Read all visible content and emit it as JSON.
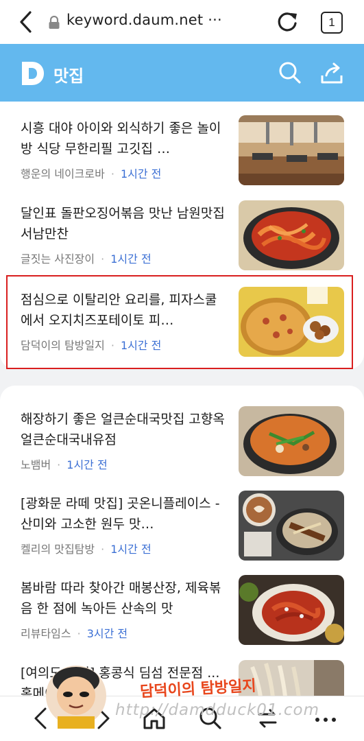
{
  "browser": {
    "url": "keyword.daum.net ···",
    "tab_count": "1"
  },
  "header": {
    "title": "맛집"
  },
  "articles": [
    {
      "title": "시흥 대야 아이와 외식하기 좋은 놀이방 식당 무한리필 고깃집 …",
      "source": "행운의 네이크로바",
      "time": "1시간 전",
      "thumb": "restaurant-interior"
    },
    {
      "title": "달인표 돌판오징어볶음 맛난 남원맛집 서남만찬",
      "source": "글짓는 사진장이",
      "time": "1시간 전",
      "thumb": "spicy-squid"
    },
    {
      "title": "점심으로 이탈리안 요리를, 피자스쿨에서 오지치즈포테이토 피…",
      "source": "담덕이의 탐방일지",
      "time": "1시간 전",
      "thumb": "pizza",
      "highlighted": true
    },
    {
      "title": "해장하기 좋은 얼큰순대국맛집 고향옥얼큰순대국내유점",
      "source": "노뱀버",
      "time": "1시간 전",
      "thumb": "sundae-soup"
    },
    {
      "title": "[광화문 라떼 맛집] 곳온니플레이스 - 산미와 고소한 원두 맛…",
      "source": "켈리의 맛집탐방",
      "time": "1시간 전",
      "thumb": "latte-dessert"
    },
    {
      "title": "봄바람 따라 찾아간 매봉산장, 제육볶음 한 점에 녹아든 산속의 맛",
      "source": "리뷰타임스",
      "time": "3시간 전",
      "thumb": "jeyuk-bokkeum"
    },
    {
      "title": "[여의도 맛집] 홍콩식 딤섬 전문점 ... 홈메이드 수제",
      "source": "",
      "time": "",
      "thumb": "noodles"
    }
  ],
  "watermark": {
    "title": "담덕이의 탐방일지",
    "url": "http://damdduck01.com"
  },
  "colors": {
    "header_bg": "#63b8ee",
    "time_blue": "#3b6fd4",
    "highlight_red": "#d91e1e"
  }
}
